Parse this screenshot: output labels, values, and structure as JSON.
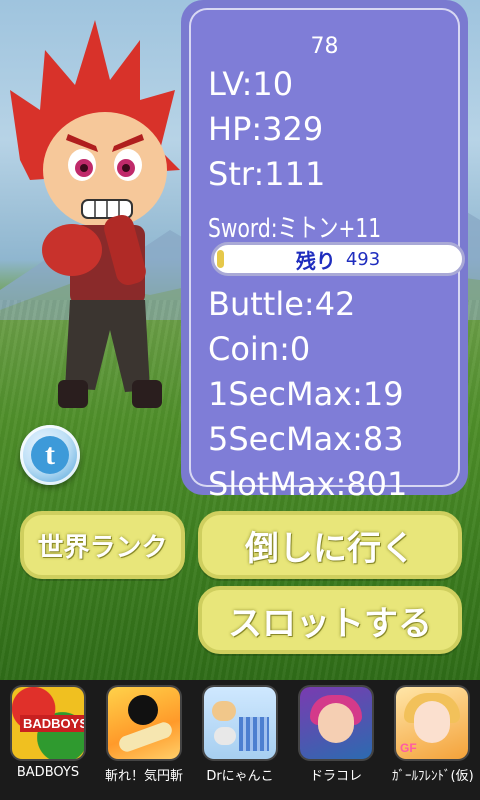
{
  "stats": {
    "count": "78",
    "lv": "LV:10",
    "hp": "HP:329",
    "str": "Str:111",
    "sword": "Sword:ミトン+11",
    "remain_label": "残り",
    "remain_value": "493",
    "battle": "Buttle:42",
    "coin": "Coin:0",
    "sec1": "1SecMax:19",
    "sec5": "5SecMax:83",
    "slot": "SlotMax:801"
  },
  "buttons": {
    "rank": "世界ランク",
    "attack": "倒しに行く",
    "slot": "スロットする"
  },
  "apps": [
    {
      "label": "BADBOYS",
      "icon": "badboys-app-icon"
    },
    {
      "label": "斬れ！気円斬",
      "icon": "kienzan-app-icon"
    },
    {
      "label": "Drにゃんこ",
      "icon": "dr-nyanko-app-icon"
    },
    {
      "label": "ドラコレ",
      "icon": "dorakore-app-icon"
    },
    {
      "label": "ｶﾞｰﾙﾌﾚﾝﾄﾞ(仮)",
      "icon": "girlfriend-app-icon"
    }
  ],
  "icon_text": {
    "badboys": "BADBOYS",
    "girlfriend": "GF"
  },
  "colors": {
    "panel": "#7a7ad0",
    "button": "#e8e67a",
    "remain_text": "#1f2dbe"
  }
}
